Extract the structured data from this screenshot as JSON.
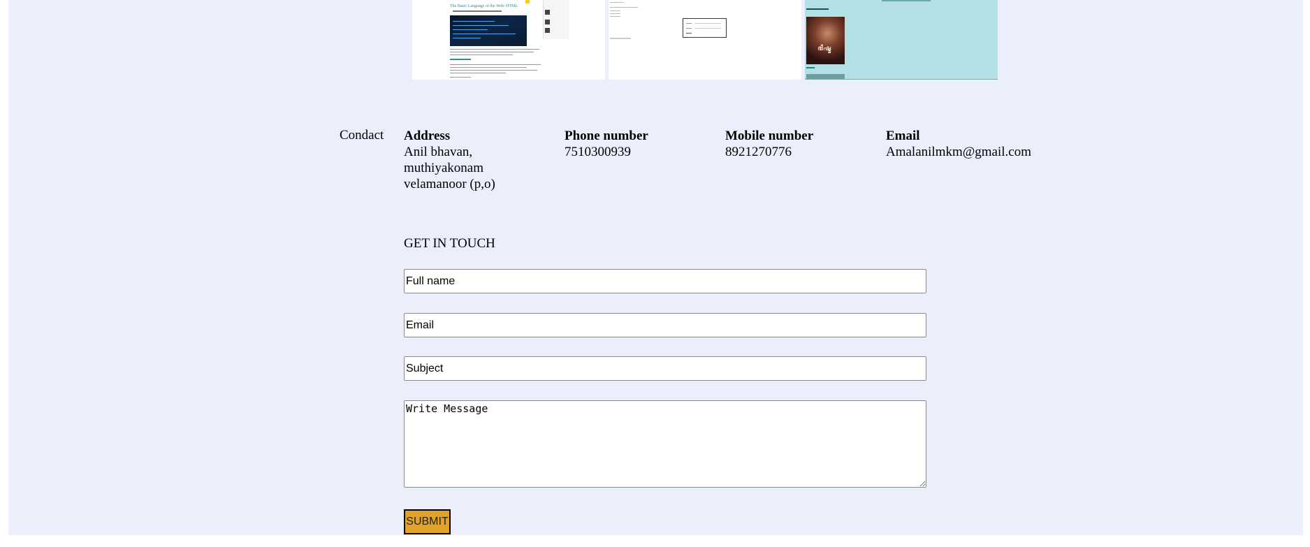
{
  "thumbnails": {
    "items": [
      {
        "title": "The Basic Language of the Web: HTML"
      },
      {
        "title": ""
      },
      {
        "title": ""
      }
    ],
    "colors": {
      "teal": "#b2e0e5"
    }
  },
  "contact": {
    "label": "Condact",
    "address": {
      "heading": "Address",
      "line1": "Anil bhavan,",
      "line2": "muthiyakonam",
      "line3": "velamanoor (p,o)"
    },
    "phone": {
      "heading": "Phone number",
      "value": "7510300939"
    },
    "mobile": {
      "heading": "Mobile number",
      "value": "8921270776"
    },
    "email": {
      "heading": "Email",
      "value": "Amalanilmkm@gmail.com"
    }
  },
  "form": {
    "title": "GET IN TOUCH",
    "fullname_placeholder": "Full name",
    "email_placeholder": "Email",
    "subject_placeholder": "Subject",
    "message_placeholder": "Write Message",
    "submit_label": "SUBMIT"
  },
  "colors": {
    "background": "#ebeffc",
    "submit": "#e0a22b"
  }
}
